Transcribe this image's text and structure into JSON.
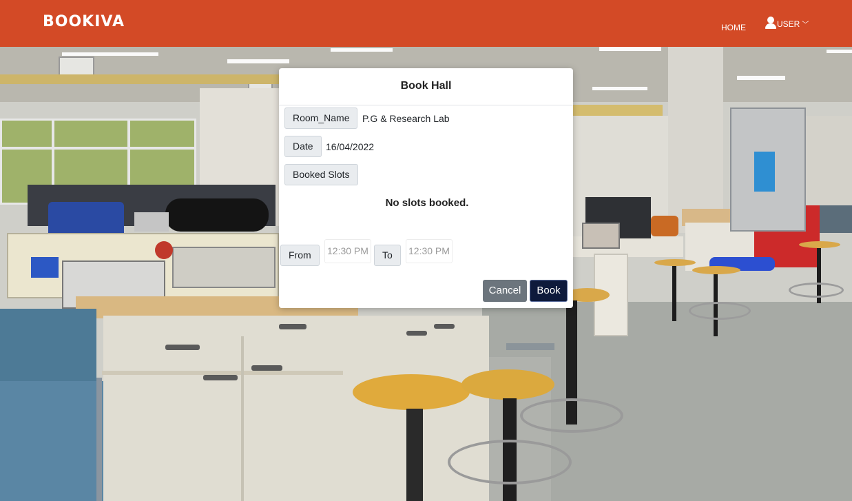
{
  "navbar": {
    "brand": "BOOKIVA",
    "home_label": "HOME",
    "user_label": "USER",
    "user_icon": "user-icon",
    "dropdown_icon": "chevron-down-icon",
    "background_color": "#d34a26"
  },
  "modal": {
    "title": "Book Hall",
    "room_name_label": "Room_Name",
    "room_name_value": "P.G & Research Lab",
    "date_label": "Date",
    "date_value": "16/04/2022",
    "booked_slots_label": "Booked Slots",
    "no_slots_message": "No slots booked.",
    "from_label": "From",
    "from_time": "12:30 PM",
    "to_label": "To",
    "to_time": "12:30 PM",
    "cancel_label": "Cancel",
    "book_label": "Book"
  }
}
